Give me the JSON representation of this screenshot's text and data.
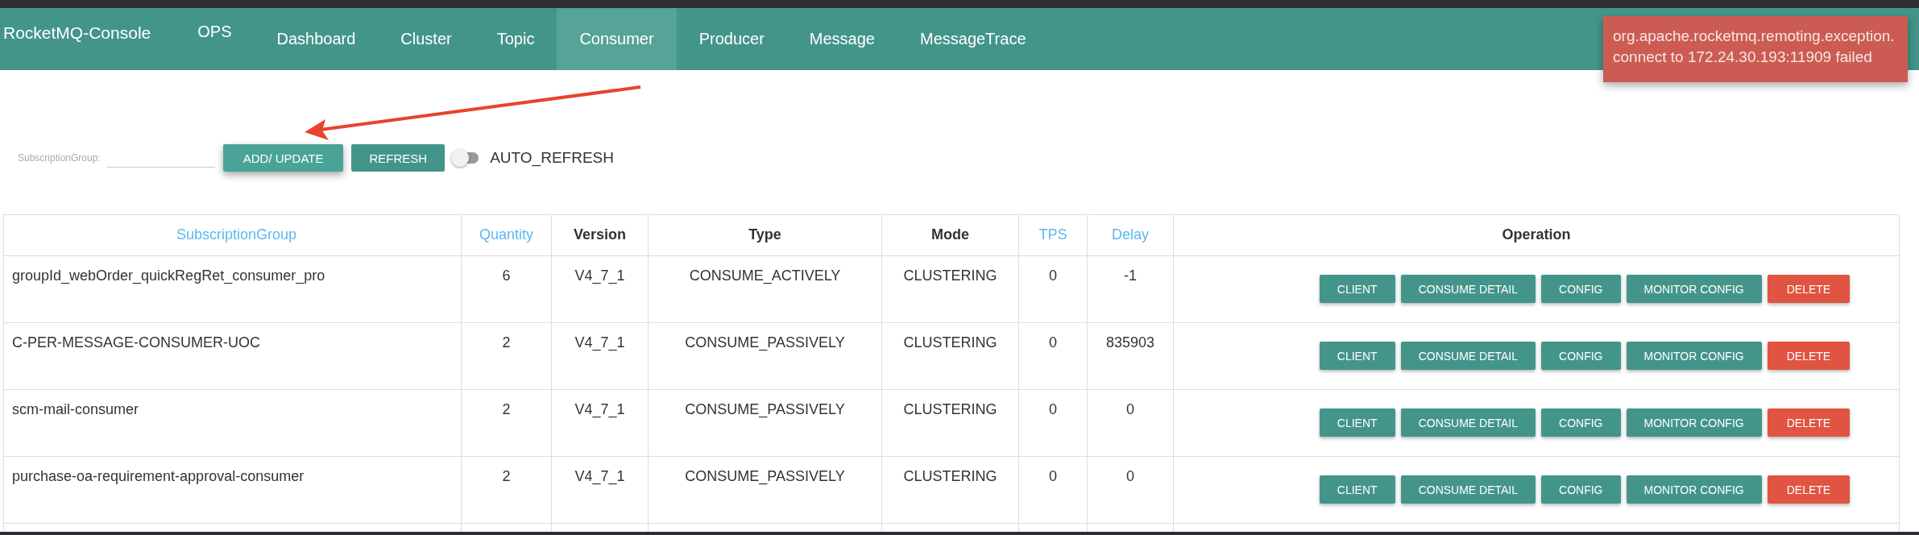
{
  "navbar": {
    "brand": "RocketMQ-Console",
    "items": [
      {
        "label": "OPS",
        "selected": false
      },
      {
        "label": "Dashboard",
        "selected": false
      },
      {
        "label": "Cluster",
        "selected": false
      },
      {
        "label": "Topic",
        "selected": false
      },
      {
        "label": "Consumer",
        "selected": true
      },
      {
        "label": "Producer",
        "selected": false
      },
      {
        "label": "Message",
        "selected": false
      },
      {
        "label": "MessageTrace",
        "selected": false
      }
    ]
  },
  "error_toast": {
    "lines": [
      "org.apache.rocketmq.remoting.exception.",
      "connect to 172.24.30.193:11909 failed"
    ]
  },
  "filter": {
    "label": "SubscriptionGroup:",
    "buttons": [
      {
        "label": "ADD/ UPDATE",
        "kind": "raised"
      },
      {
        "label": "REFRESH",
        "kind": "flat"
      }
    ],
    "auto_refresh": {
      "label": "AUTO_REFRESH",
      "on": false
    }
  },
  "table": {
    "columns": [
      {
        "label": "SubscriptionGroup",
        "sortable": true
      },
      {
        "label": "Quantity",
        "sortable": true
      },
      {
        "label": "Version",
        "sortable": false
      },
      {
        "label": "Type",
        "sortable": false
      },
      {
        "label": "Mode",
        "sortable": false
      },
      {
        "label": "TPS",
        "sortable": true
      },
      {
        "label": "Delay",
        "sortable": true
      },
      {
        "label": "Operation",
        "sortable": false
      }
    ],
    "rows": [
      {
        "cells": [
          "groupId_webOrder_quickRegRet_consumer_pro",
          "6",
          "V4_7_1",
          "CONSUME_ACTIVELY",
          "CLUSTERING",
          "0",
          "-1"
        ],
        "actions": [
          {
            "label": "CLIENT",
            "kind": "normal"
          },
          {
            "label": "CONSUME DETAIL",
            "kind": "normal"
          },
          {
            "label": "CONFIG",
            "kind": "normal"
          },
          {
            "label": "MONITOR CONFIG",
            "kind": "normal"
          },
          {
            "label": "DELETE",
            "kind": "danger"
          }
        ]
      },
      {
        "cells": [
          "C-PER-MESSAGE-CONSUMER-UOC",
          "2",
          "V4_7_1",
          "CONSUME_PASSIVELY",
          "CLUSTERING",
          "0",
          "835903"
        ],
        "actions": [
          {
            "label": "CLIENT",
            "kind": "normal"
          },
          {
            "label": "CONSUME DETAIL",
            "kind": "normal"
          },
          {
            "label": "CONFIG",
            "kind": "normal"
          },
          {
            "label": "MONITOR CONFIG",
            "kind": "normal"
          },
          {
            "label": "DELETE",
            "kind": "danger"
          }
        ]
      },
      {
        "cells": [
          "scm-mail-consumer",
          "2",
          "V4_7_1",
          "CONSUME_PASSIVELY",
          "CLUSTERING",
          "0",
          "0"
        ],
        "actions": [
          {
            "label": "CLIENT",
            "kind": "normal"
          },
          {
            "label": "CONSUME DETAIL",
            "kind": "normal"
          },
          {
            "label": "CONFIG",
            "kind": "normal"
          },
          {
            "label": "MONITOR CONFIG",
            "kind": "normal"
          },
          {
            "label": "DELETE",
            "kind": "danger"
          }
        ]
      },
      {
        "cells": [
          "purchase-oa-requirement-approval-consumer",
          "2",
          "V4_7_1",
          "CONSUME_PASSIVELY",
          "CLUSTERING",
          "0",
          "0"
        ],
        "actions": [
          {
            "label": "CLIENT",
            "kind": "normal"
          },
          {
            "label": "CONSUME DETAIL",
            "kind": "normal"
          },
          {
            "label": "CONFIG",
            "kind": "normal"
          },
          {
            "label": "MONITOR CONFIG",
            "kind": "normal"
          },
          {
            "label": "DELETE",
            "kind": "danger"
          }
        ]
      }
    ]
  }
}
